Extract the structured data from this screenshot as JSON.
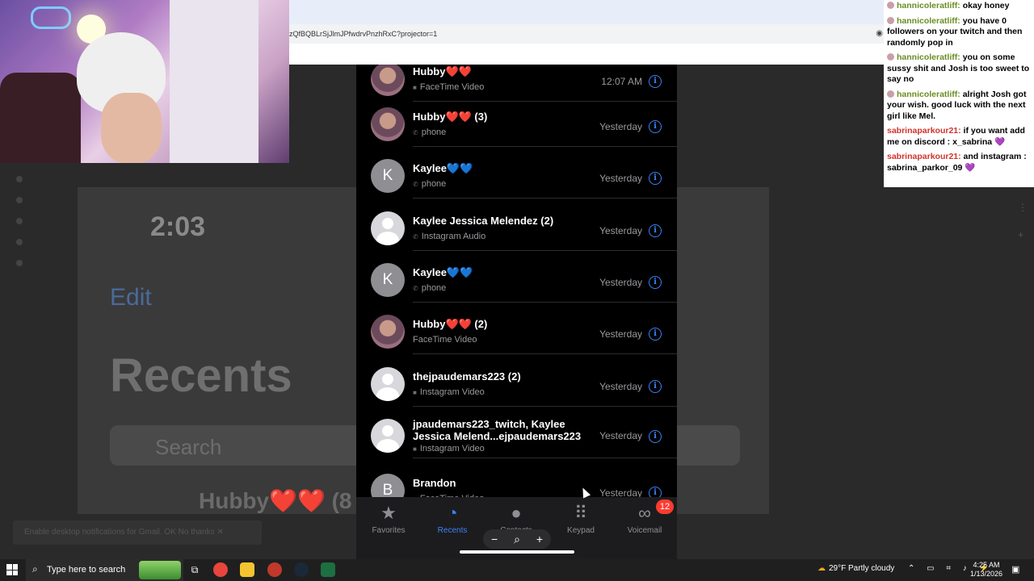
{
  "browser": {
    "url": "zQfBQBLrSjJlmJPfwdrvPnzhRxC?projector=1"
  },
  "background": {
    "time": "2:03",
    "edit": "Edit",
    "title": "Recents",
    "search_placeholder": "Search",
    "first_entry": "Hubby❤️❤️ (8",
    "toast": "Enable desktop notifications for Gmail.   OK   No thanks   ✕"
  },
  "calls": [
    {
      "name": "Hubby❤️❤️",
      "type": "FaceTime Video",
      "type_icon": "video-icon",
      "time": "12:07 AM",
      "avatar": "photo"
    },
    {
      "name": "Hubby❤️❤️ (3)",
      "type": "phone",
      "type_icon": "phone-icon",
      "time": "Yesterday",
      "avatar": "photo"
    },
    {
      "name": "Kaylee💙💙",
      "type": "phone",
      "type_icon": "phone-icon",
      "time": "Yesterday",
      "avatar": "letter",
      "letter": "K"
    },
    {
      "name": "Kaylee Jessica Melendez (2)",
      "type": "Instagram Audio",
      "type_icon": "phone-icon",
      "time": "Yesterday",
      "avatar": "generic"
    },
    {
      "name": "Kaylee💙💙",
      "type": "phone",
      "type_icon": "phone-icon",
      "time": "Yesterday",
      "avatar": "letter",
      "letter": "K"
    },
    {
      "name": "Hubby❤️❤️ (2)",
      "type": "FaceTime Video",
      "type_icon": "none",
      "time": "Yesterday",
      "avatar": "photo"
    },
    {
      "name": "thejpaudemars223 (2)",
      "type": "Instagram Video",
      "type_icon": "video-icon",
      "time": "Yesterday",
      "avatar": "generic"
    },
    {
      "name": "jpaudemars223_twitch, Kaylee Jessica Melend...ejpaudemars223",
      "type": "Instagram Video",
      "type_icon": "video-icon",
      "time": "Yesterday",
      "avatar": "generic"
    },
    {
      "name": "Brandon",
      "type": "FaceTime Video",
      "type_icon": "video-icon",
      "time": "Yesterday",
      "avatar": "letter",
      "letter": "B"
    }
  ],
  "tabbar": {
    "tabs": [
      {
        "label": "Favorites",
        "icon": "star-icon"
      },
      {
        "label": "Recents",
        "icon": "clock-icon",
        "active": true
      },
      {
        "label": "Contacts",
        "icon": "person-icon"
      },
      {
        "label": "Keypad",
        "icon": "keypad-icon"
      },
      {
        "label": "Voicemail",
        "icon": "voicemail-icon"
      }
    ],
    "voicemail_badge": "12"
  },
  "chat": [
    {
      "user": "hannicoleratliff:",
      "text": "okay honey",
      "color": "green"
    },
    {
      "user": "hannicoleratliff:",
      "text": "you have 0 followers on your twitch and then randomly pop in",
      "color": "green"
    },
    {
      "user": "hannicoleratliff:",
      "text": "you on some sussy shit and Josh is too sweet to say no",
      "color": "green"
    },
    {
      "user": "hannicoleratliff:",
      "text": "alright Josh got your wish. good luck with the next girl like Mel.",
      "color": "green"
    },
    {
      "user": "sabrinaparkour21:",
      "text": "if you want add me on discord : x_sabrina 💜",
      "color": "red"
    },
    {
      "user": "sabrinaparkour21:",
      "text": "and instagram : sabrina_parkor_09 💜",
      "color": "red"
    }
  ],
  "taskbar": {
    "search_placeholder": "Type here to search",
    "weather": "29°F  Partly cloudy",
    "time": "4:25 AM",
    "date": "1/13/2026",
    "accent": "#3b82f6"
  }
}
